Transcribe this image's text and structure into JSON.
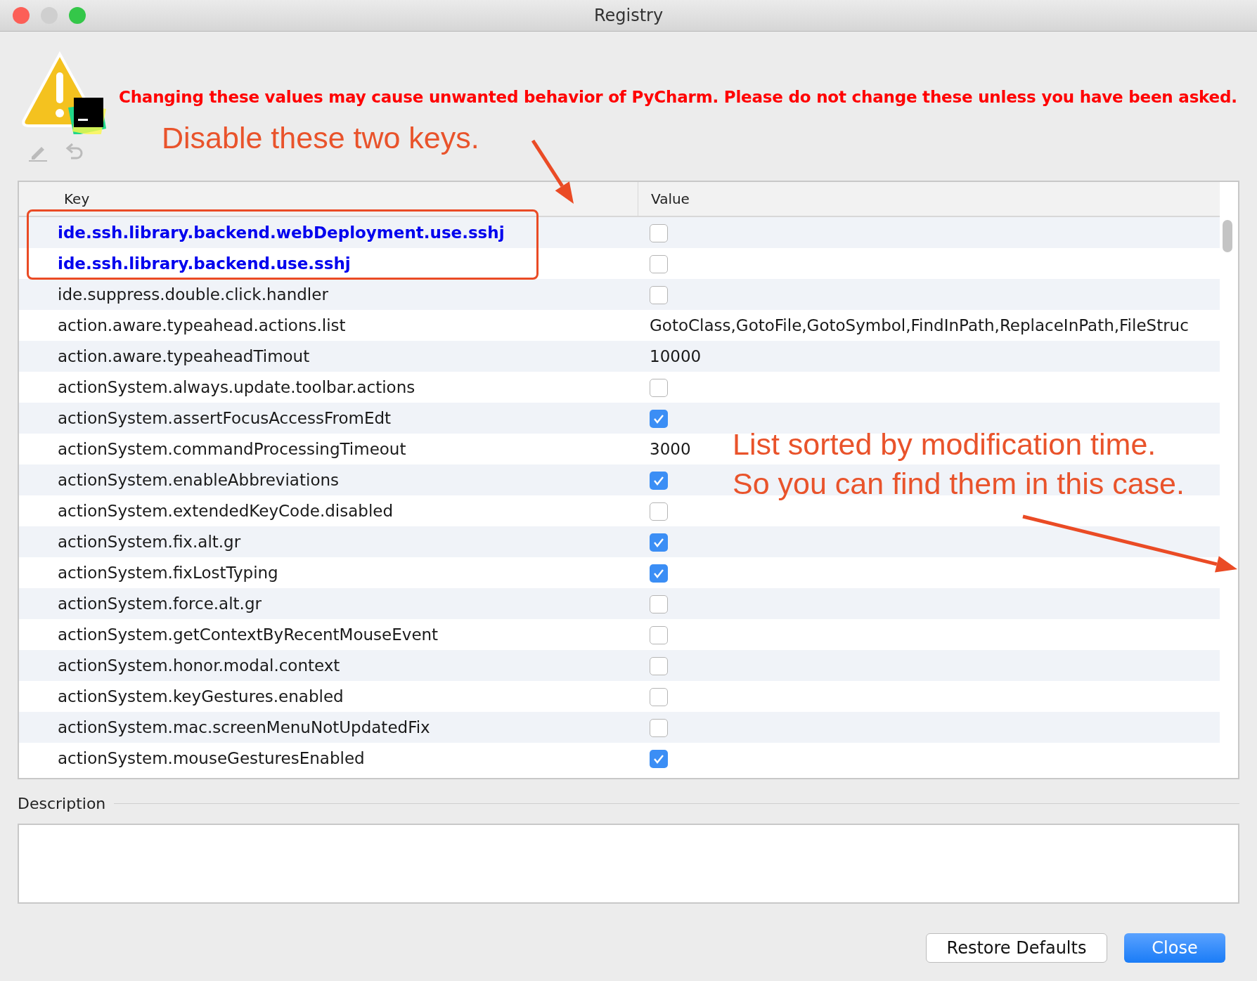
{
  "window": {
    "title": "Registry"
  },
  "warning": "Changing these values may cause unwanted behavior of PyCharm. Please do not change these unless you have been asked.",
  "table": {
    "columns": [
      "Key",
      "Value"
    ],
    "rows": [
      {
        "key": "ide.ssh.library.backend.webDeployment.use.sshj",
        "kind": "checkbox",
        "checked": false,
        "modified": true
      },
      {
        "key": "ide.ssh.library.backend.use.sshj",
        "kind": "checkbox",
        "checked": false,
        "modified": true
      },
      {
        "key": "ide.suppress.double.click.handler",
        "kind": "checkbox",
        "checked": false,
        "modified": false
      },
      {
        "key": "action.aware.typeahead.actions.list",
        "kind": "text",
        "value": "GotoClass,GotoFile,GotoSymbol,FindInPath,ReplaceInPath,FileStruc",
        "modified": false
      },
      {
        "key": "action.aware.typeaheadTimout",
        "kind": "text",
        "value": "10000",
        "modified": false
      },
      {
        "key": "actionSystem.always.update.toolbar.actions",
        "kind": "checkbox",
        "checked": false,
        "modified": false
      },
      {
        "key": "actionSystem.assertFocusAccessFromEdt",
        "kind": "checkbox",
        "checked": true,
        "modified": false
      },
      {
        "key": "actionSystem.commandProcessingTimeout",
        "kind": "text",
        "value": "3000",
        "modified": false
      },
      {
        "key": "actionSystem.enableAbbreviations",
        "kind": "checkbox",
        "checked": true,
        "modified": false
      },
      {
        "key": "actionSystem.extendedKeyCode.disabled",
        "kind": "checkbox",
        "checked": false,
        "modified": false
      },
      {
        "key": "actionSystem.fix.alt.gr",
        "kind": "checkbox",
        "checked": true,
        "modified": false
      },
      {
        "key": "actionSystem.fixLostTyping",
        "kind": "checkbox",
        "checked": true,
        "modified": false
      },
      {
        "key": "actionSystem.force.alt.gr",
        "kind": "checkbox",
        "checked": false,
        "modified": false
      },
      {
        "key": "actionSystem.getContextByRecentMouseEvent",
        "kind": "checkbox",
        "checked": false,
        "modified": false
      },
      {
        "key": "actionSystem.honor.modal.context",
        "kind": "checkbox",
        "checked": false,
        "modified": false
      },
      {
        "key": "actionSystem.keyGestures.enabled",
        "kind": "checkbox",
        "checked": false,
        "modified": false
      },
      {
        "key": "actionSystem.mac.screenMenuNotUpdatedFix",
        "kind": "checkbox",
        "checked": false,
        "modified": false
      },
      {
        "key": "actionSystem.mouseGesturesEnabled",
        "kind": "checkbox",
        "checked": true,
        "modified": false
      }
    ]
  },
  "description": {
    "label": "Description"
  },
  "buttons": [
    {
      "label": "Restore Defaults",
      "kind": "secondary"
    },
    {
      "label": "Close",
      "kind": "primary"
    }
  ],
  "annotations": [
    {
      "text": "Disable these two keys."
    },
    {
      "text": "List sorted by modification time."
    },
    {
      "text": "So you can find them in this case."
    }
  ]
}
